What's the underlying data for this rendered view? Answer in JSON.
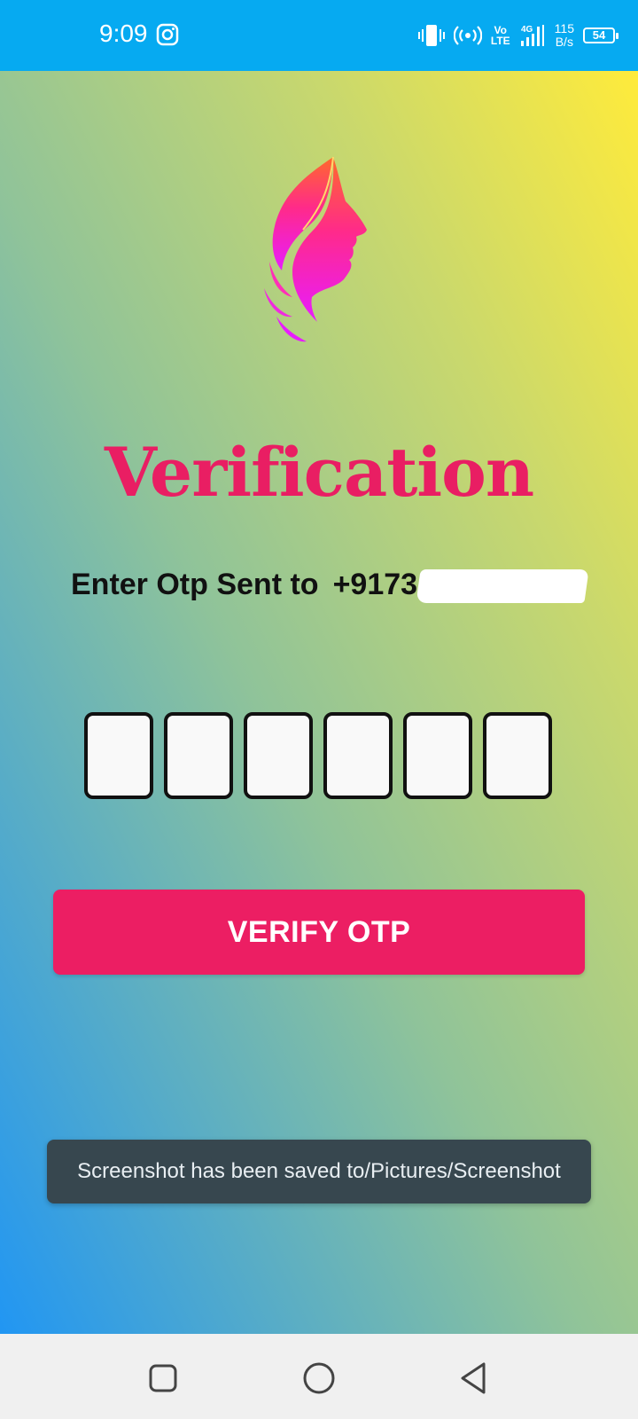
{
  "status_bar": {
    "time": "9:09",
    "network_speed_value": "115",
    "network_speed_unit": "B/s",
    "battery_level": "54",
    "volte_label_top": "Vo",
    "volte_label_bottom": "LTE",
    "network_type": "4G",
    "icons": [
      "instagram-icon",
      "vibrate-icon",
      "hotspot-icon",
      "signal-icon",
      "battery-icon"
    ]
  },
  "screen": {
    "title": "Verification",
    "otp_prompt": "Enter Otp Sent to",
    "phone_prefix": "+9173",
    "otp_digits": [
      "",
      "",
      "",
      "",
      "",
      ""
    ],
    "verify_button_label": "VERIFY OTP"
  },
  "toast": {
    "message": "Screenshot has been saved to/Pictures/Screenshot"
  },
  "nav_bar": {
    "buttons": [
      "recent-apps",
      "home",
      "back"
    ]
  },
  "colors": {
    "status_bar": "#06aaf1",
    "accent": "#ec1e63",
    "gradient_top_right": "#ffeb3b",
    "gradient_bottom_left": "#2196f3",
    "toast_bg": "#37474f"
  }
}
